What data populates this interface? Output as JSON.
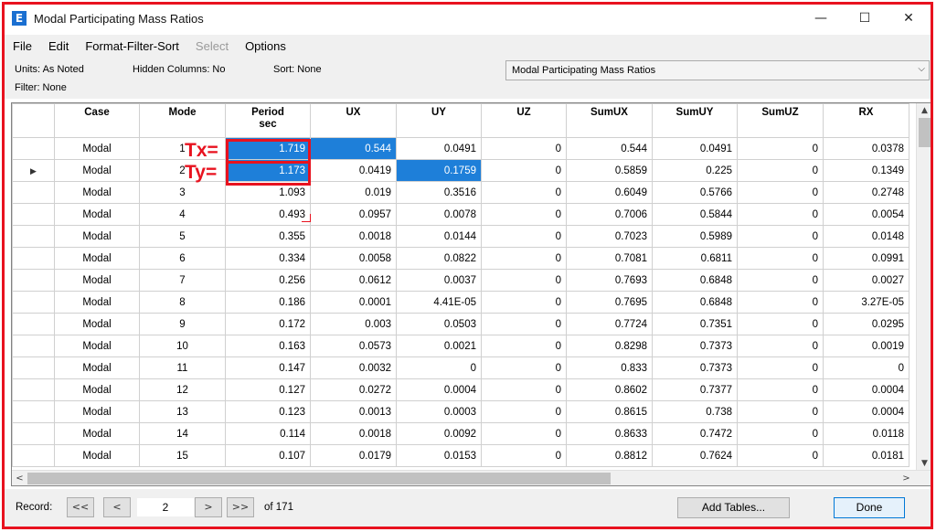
{
  "window": {
    "app_icon_letter": "E",
    "title": "Modal Participating Mass Ratios",
    "minimize_glyph": "—",
    "maximize_glyph": "☐",
    "close_glyph": "✕"
  },
  "menu": [
    "File",
    "Edit",
    "Format-Filter-Sort",
    "Select",
    "Options"
  ],
  "info": {
    "units": "Units:  As Noted",
    "hidden_columns": "Hidden Columns:  No",
    "sort": "Sort:  None",
    "filter": "Filter:  None",
    "table_selector": "Modal Participating Mass Ratios"
  },
  "columns": [
    {
      "line1": "Case",
      "line2": ""
    },
    {
      "line1": "Mode",
      "line2": ""
    },
    {
      "line1": "Period",
      "line2": "sec"
    },
    {
      "line1": "UX",
      "line2": ""
    },
    {
      "line1": "UY",
      "line2": ""
    },
    {
      "line1": "UZ",
      "line2": ""
    },
    {
      "line1": "SumUX",
      "line2": ""
    },
    {
      "line1": "SumUY",
      "line2": ""
    },
    {
      "line1": "SumUZ",
      "line2": ""
    },
    {
      "line1": "RX",
      "line2": ""
    }
  ],
  "rows": [
    [
      "Modal",
      "1",
      "1.719",
      "0.544",
      "0.0491",
      "0",
      "0.544",
      "0.0491",
      "0",
      "0.0378"
    ],
    [
      "Modal",
      "2",
      "1.173",
      "0.0419",
      "0.1759",
      "0",
      "0.5859",
      "0.225",
      "0",
      "0.1349"
    ],
    [
      "Modal",
      "3",
      "1.093",
      "0.019",
      "0.3516",
      "0",
      "0.6049",
      "0.5766",
      "0",
      "0.2748"
    ],
    [
      "Modal",
      "4",
      "0.493",
      "0.0957",
      "0.0078",
      "0",
      "0.7006",
      "0.5844",
      "0",
      "0.0054"
    ],
    [
      "Modal",
      "5",
      "0.355",
      "0.0018",
      "0.0144",
      "0",
      "0.7023",
      "0.5989",
      "0",
      "0.0148"
    ],
    [
      "Modal",
      "6",
      "0.334",
      "0.0058",
      "0.0822",
      "0",
      "0.7081",
      "0.6811",
      "0",
      "0.0991"
    ],
    [
      "Modal",
      "7",
      "0.256",
      "0.0612",
      "0.0037",
      "0",
      "0.7693",
      "0.6848",
      "0",
      "0.0027"
    ],
    [
      "Modal",
      "8",
      "0.186",
      "0.0001",
      "4.41E-05",
      "0",
      "0.7695",
      "0.6848",
      "0",
      "3.27E-05"
    ],
    [
      "Modal",
      "9",
      "0.172",
      "0.003",
      "0.0503",
      "0",
      "0.7724",
      "0.7351",
      "0",
      "0.0295"
    ],
    [
      "Modal",
      "10",
      "0.163",
      "0.0573",
      "0.0021",
      "0",
      "0.8298",
      "0.7373",
      "0",
      "0.0019"
    ],
    [
      "Modal",
      "11",
      "0.147",
      "0.0032",
      "0",
      "0",
      "0.833",
      "0.7373",
      "0",
      "0"
    ],
    [
      "Modal",
      "12",
      "0.127",
      "0.0272",
      "0.0004",
      "0",
      "0.8602",
      "0.7377",
      "0",
      "0.0004"
    ],
    [
      "Modal",
      "13",
      "0.123",
      "0.0013",
      "0.0003",
      "0",
      "0.8615",
      "0.738",
      "0",
      "0.0004"
    ],
    [
      "Modal",
      "14",
      "0.114",
      "0.0018",
      "0.0092",
      "0",
      "0.8633",
      "0.7472",
      "0",
      "0.0118"
    ],
    [
      "Modal",
      "15",
      "0.107",
      "0.0179",
      "0.0153",
      "0",
      "0.8812",
      "0.7624",
      "0",
      "0.0181"
    ]
  ],
  "selected_cells": [
    [
      0,
      2
    ],
    [
      0,
      3
    ],
    [
      1,
      2
    ],
    [
      1,
      4
    ]
  ],
  "current_row_index": 1,
  "annotations": {
    "tx_label": "Tx=",
    "ty_label": "Ty="
  },
  "footer": {
    "record_label": "Record:",
    "first_glyph": "<<",
    "prev_glyph": "<",
    "record_value": "2",
    "next_glyph": ">",
    "last_glyph": ">>",
    "of_total": "of 171",
    "add_tables_label": "Add Tables...",
    "done_label": "Done"
  },
  "scroll": {
    "up_glyph": "▲",
    "down_glyph": "▼",
    "left_glyph": "<",
    "right_glyph": ">"
  },
  "colors": {
    "selection": "#1e7fd9",
    "annotation": "#e8121f",
    "app_icon": "#1a6fd1"
  }
}
